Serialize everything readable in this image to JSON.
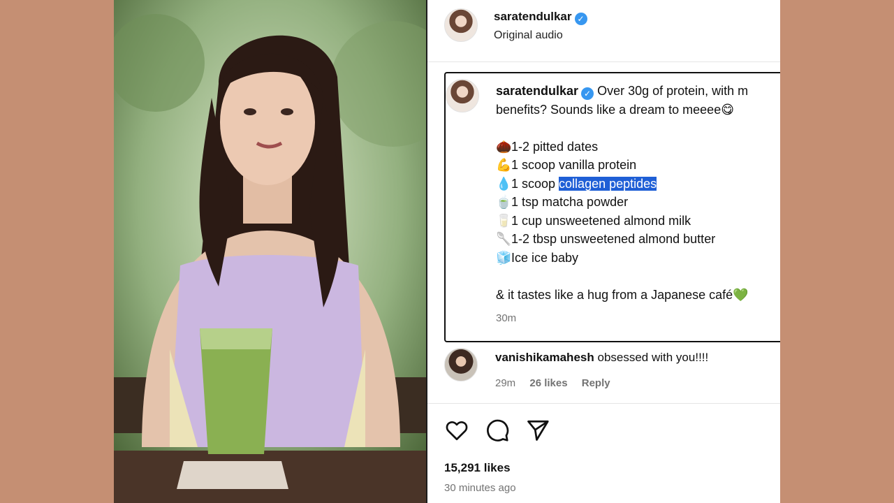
{
  "header": {
    "username": "saratendulkar",
    "subtitle": "Original audio"
  },
  "caption": {
    "username": "saratendulkar",
    "line1": "Over 30g of protein, with m",
    "line2": "benefits? Sounds like a dream to meeee",
    "line2_emoji": "😋",
    "items": [
      {
        "emoji": "🌰",
        "pre": "1-2 pitted dates",
        "hl": "",
        "post": ""
      },
      {
        "emoji": "💪",
        "pre": "1 scoop vanilla protein",
        "hl": "",
        "post": ""
      },
      {
        "emoji": "💧",
        "pre": "1 scoop ",
        "hl": "collagen peptides",
        "post": ""
      },
      {
        "emoji": "🍵",
        "pre": "1 tsp matcha powder",
        "hl": "",
        "post": ""
      },
      {
        "emoji": "🥛",
        "pre": "1 cup unsweetened almond milk",
        "hl": "",
        "post": ""
      },
      {
        "emoji": "🥄",
        "pre": "1-2 tbsp unsweetened almond butter",
        "hl": "",
        "post": ""
      },
      {
        "emoji": "🧊",
        "pre": "Ice ice baby",
        "hl": "",
        "post": ""
      }
    ],
    "closing": "& it tastes like a hug from a Japanese café",
    "closing_emoji": "💚",
    "time": "30m"
  },
  "comment": {
    "username": "vanishikamahesh",
    "text": "obsessed with you!!!!",
    "time": "29m",
    "likes": "26 likes",
    "reply": "Reply"
  },
  "actions": {
    "like_icon": "heart-icon",
    "comment_icon": "comment-icon",
    "share_icon": "send-icon"
  },
  "likes_count": "15,291 likes",
  "posted": "30 minutes ago",
  "colors": {
    "background": "#c58f73",
    "verified": "#3797f0",
    "highlight": "#1f5fd6"
  }
}
